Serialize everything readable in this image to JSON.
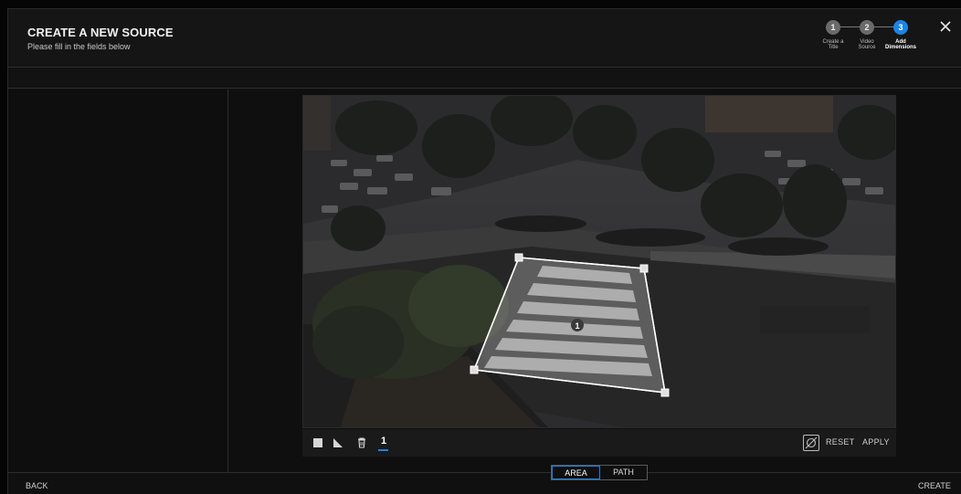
{
  "header": {
    "title": "CREATE A NEW SOURCE",
    "subtitle": "Please fill in the fields below",
    "close_icon": "close-icon"
  },
  "steps": [
    {
      "number": "1",
      "label_line1": "Create a",
      "label_line2": "Title",
      "active": false
    },
    {
      "number": "2",
      "label_line1": "Video",
      "label_line2": "Source",
      "active": false
    },
    {
      "number": "3",
      "label_line1": "Add",
      "label_line2": "Dimensions",
      "active": true
    }
  ],
  "canvas": {
    "area_label": "1"
  },
  "toolbar": {
    "tools": [
      "square-icon",
      "triangle-ruler-icon",
      "trash-icon"
    ],
    "selected_area": "1",
    "hide_icon": "eye-off-icon",
    "reset_label": "RESET",
    "apply_label": "APPLY"
  },
  "mode_switch": {
    "options": [
      "AREA",
      "PATH"
    ],
    "selected": "AREA"
  },
  "footer": {
    "back_label": "BACK",
    "create_label": "CREATE"
  },
  "colors": {
    "accent": "#1a84e6",
    "background": "#111111"
  }
}
